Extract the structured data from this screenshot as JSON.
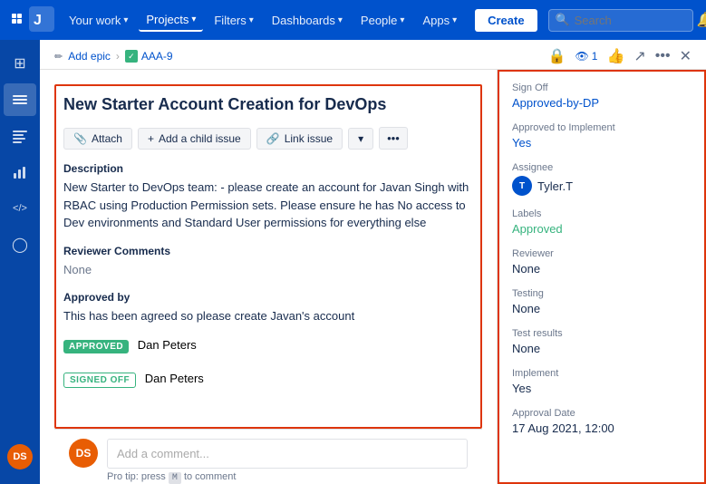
{
  "nav": {
    "items": [
      {
        "label": "Your work",
        "id": "your-work",
        "hasChevron": true
      },
      {
        "label": "Projects",
        "id": "projects",
        "hasChevron": true,
        "active": true
      },
      {
        "label": "Filters",
        "id": "filters",
        "hasChevron": true
      },
      {
        "label": "Dashboards",
        "id": "dashboards",
        "hasChevron": true
      },
      {
        "label": "People",
        "id": "people",
        "hasChevron": true
      },
      {
        "label": "Apps",
        "id": "apps",
        "hasChevron": true
      }
    ],
    "search_placeholder": "Search",
    "create_label": "Create"
  },
  "sidebar": {
    "items": [
      {
        "id": "home",
        "icon": "⊞",
        "label": "Home"
      },
      {
        "id": "board",
        "icon": "☰",
        "label": "Board"
      },
      {
        "id": "backlog",
        "icon": "≡",
        "label": "Backlog"
      },
      {
        "id": "reports",
        "icon": "📊",
        "label": "Reports"
      },
      {
        "id": "code",
        "icon": "</>",
        "label": "Code"
      },
      {
        "id": "releases",
        "icon": "◯",
        "label": "Releases"
      }
    ],
    "avatar_initials": "DS"
  },
  "breadcrumb": {
    "edit_label": "Add epic",
    "issue_id": "AAA-9",
    "issue_icon": "✓"
  },
  "toolbar": {
    "attach_label": "Attach",
    "add_child_label": "Add a child issue",
    "link_issue_label": "Link issue"
  },
  "issue": {
    "title": "New Starter Account Creation for DevOps",
    "description_label": "Description",
    "description_text": "New Starter to DevOps team: - please create an account for Javan Singh with RBAC using Production Permission sets. Please ensure he has No access to Dev environments and Standard User permissions for everything else",
    "reviewer_comments_label": "Reviewer Comments",
    "reviewer_comments_value": "None",
    "approved_by_label": "Approved by",
    "approved_by_text": "This has been agreed so please create Javan's account",
    "approved_badge": "APPROVED",
    "approved_name": "Dan Peters",
    "signed_badge": "SIGNED OFF",
    "signed_name": "Dan Peters"
  },
  "meta": {
    "sign_off_label": "Sign Off",
    "sign_off_value": "Approved-by-DP",
    "approved_implement_label": "Approved to Implement",
    "approved_implement_value": "Yes",
    "assignee_label": "Assignee",
    "assignee_value": "Tyler.T",
    "assignee_initials": "T",
    "labels_label": "Labels",
    "labels_value": "Approved",
    "reviewer_label": "Reviewer",
    "reviewer_value": "None",
    "testing_label": "Testing",
    "testing_value": "None",
    "test_results_label": "Test results",
    "test_results_value": "None",
    "implement_label": "Implement",
    "implement_value": "Yes",
    "approval_date_label": "Approval Date",
    "approval_date_value": "17 Aug 2021, 12:00"
  },
  "comment": {
    "avatar_initials": "DS",
    "placeholder": "Add a comment...",
    "tip": "Pro tip: press",
    "tip_key": "M",
    "tip_suffix": "to comment"
  },
  "watches": {
    "count": "1"
  }
}
